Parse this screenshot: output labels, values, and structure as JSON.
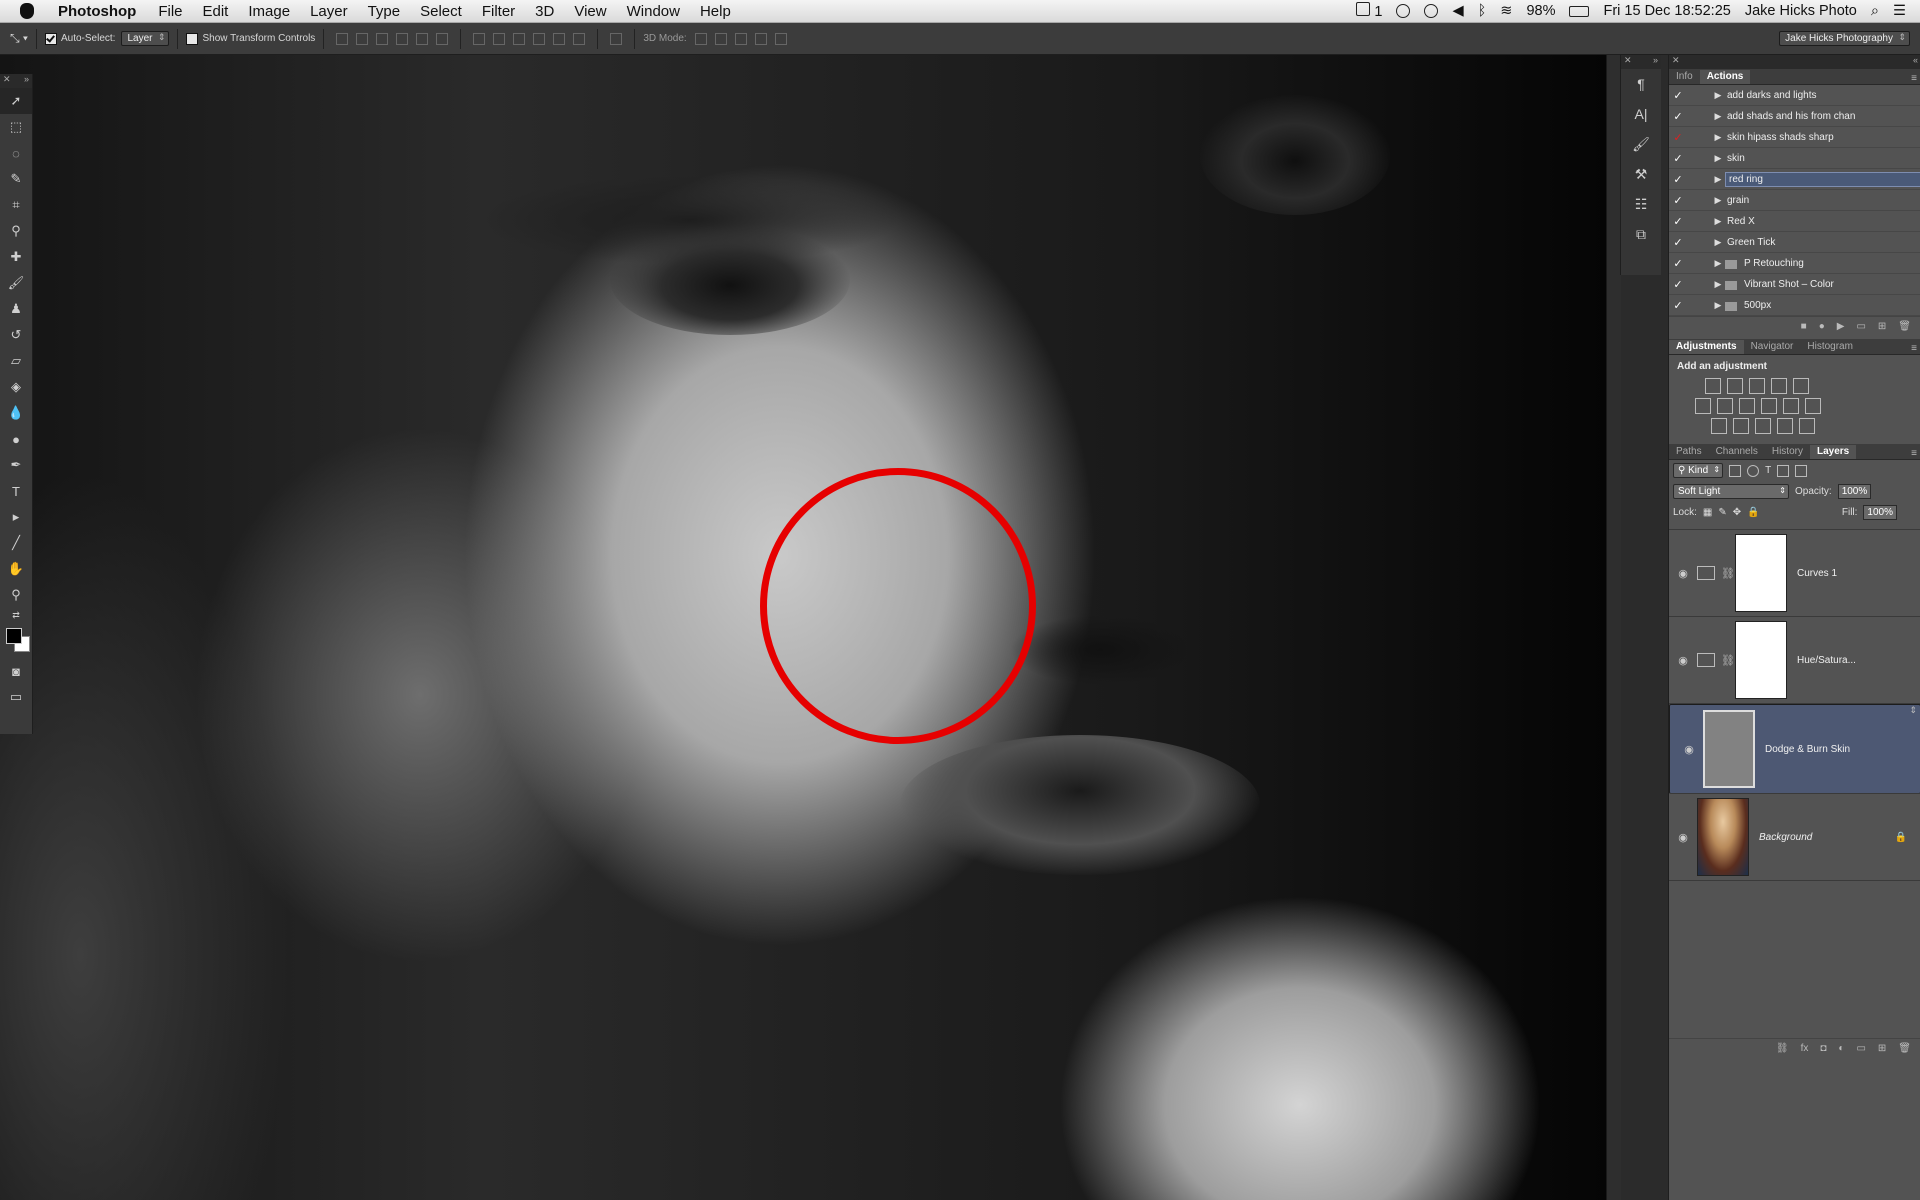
{
  "menubar": {
    "app": "Photoshop",
    "items": [
      "File",
      "Edit",
      "Image",
      "Layer",
      "Type",
      "Select",
      "Filter",
      "3D",
      "View",
      "Window",
      "Help"
    ],
    "status": {
      "badge": "1",
      "battery": "98%",
      "datetime": "Fri 15 Dec  18:52:25",
      "user": "Jake Hicks Photo"
    }
  },
  "optionsbar": {
    "auto_select_label": "Auto-Select:",
    "auto_select_value": "Layer",
    "show_transform_label": "Show Transform Controls",
    "mode_label": "3D Mode:",
    "workspace": "Jake Hicks Photography"
  },
  "actions_panel": {
    "tabs": [
      "Info",
      "Actions"
    ],
    "active_tab": "Actions",
    "items": [
      {
        "label": "add darks and lights",
        "tick": "✓",
        "tick_color": "#ffffff",
        "folder": false
      },
      {
        "label": "add shads and his from chan",
        "tick": "✓",
        "tick_color": "#ffffff",
        "folder": false
      },
      {
        "label": "skin hipass shads sharp",
        "tick": "✓",
        "tick_color": "#e02020",
        "folder": false
      },
      {
        "label": "skin",
        "tick": "✓",
        "tick_color": "#ffffff",
        "folder": false
      },
      {
        "label": "red ring",
        "tick": "✓",
        "tick_color": "#ffffff",
        "folder": false,
        "highlighted": true
      },
      {
        "label": "grain",
        "tick": "✓",
        "tick_color": "#ffffff",
        "folder": false
      },
      {
        "label": "Red X",
        "tick": "✓",
        "tick_color": "#ffffff",
        "folder": false
      },
      {
        "label": "Green Tick",
        "tick": "✓",
        "tick_color": "#ffffff",
        "folder": false
      },
      {
        "label": "P Retouching",
        "tick": "✓",
        "tick_color": "#ffffff",
        "folder": true
      },
      {
        "label": "Vibrant Shot – Color",
        "tick": "✓",
        "tick_color": "#ffffff",
        "folder": true
      },
      {
        "label": "500px",
        "tick": "✓",
        "tick_color": "#ffffff",
        "folder": true
      }
    ]
  },
  "adjustments_panel": {
    "tabs": [
      "Adjustments",
      "Navigator",
      "Histogram"
    ],
    "active_tab": "Adjustments",
    "title": "Add an adjustment"
  },
  "layers_panel": {
    "tabs": [
      "Paths",
      "Channels",
      "History",
      "Layers"
    ],
    "active_tab": "Layers",
    "filter": "Kind",
    "blend_mode": "Soft Light",
    "opacity_label": "Opacity:",
    "opacity": "100%",
    "lock_label": "Lock:",
    "fill_label": "Fill:",
    "fill": "100%",
    "layers": [
      {
        "name": "Curves 1",
        "type": "curves",
        "selected": false
      },
      {
        "name": "Hue/Satura...",
        "type": "huesat",
        "selected": false
      },
      {
        "name": "Dodge & Burn Skin",
        "type": "grey",
        "selected": true
      },
      {
        "name": "Background",
        "type": "photo",
        "selected": false,
        "locked": true
      }
    ]
  },
  "annotation": {
    "ring_color": "#e60000"
  }
}
